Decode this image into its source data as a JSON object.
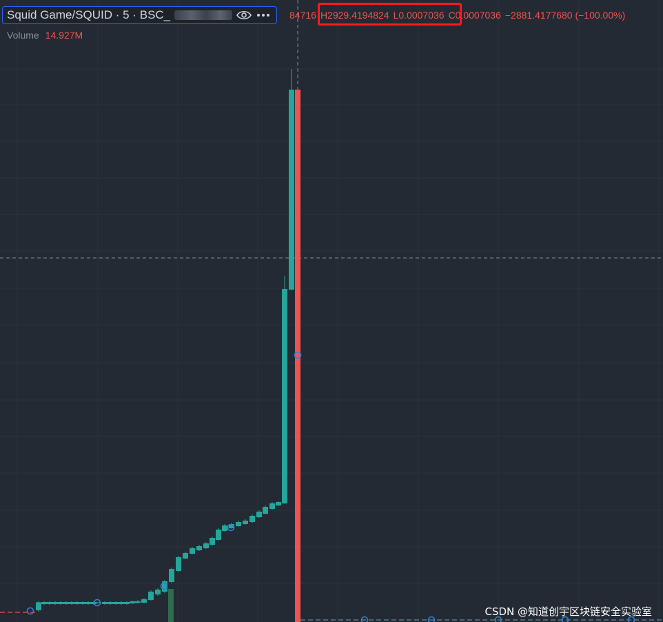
{
  "legend": {
    "symbol": "Squid Game/SQUID · 5 · BSC_",
    "eye_icon": "eye-icon",
    "more_icon": "more-horizontal-icon"
  },
  "ohlc": {
    "open_partial": "84716",
    "high": "H2929.4194824",
    "low": "L0.0007036",
    "close": "C0.0007036",
    "change": "−2881.4177680 (−100.00%)"
  },
  "volume": {
    "label": "Volume",
    "value": "14.927M"
  },
  "watermark": "CSDN @知道创宇区块链安全实验室",
  "colors": {
    "background": "#232a33",
    "grid": "#2c333d",
    "up": "#26a69a",
    "down": "#ef5350",
    "highlight_box": "#ff1a1a",
    "legend_border": "#2962ff"
  }
}
